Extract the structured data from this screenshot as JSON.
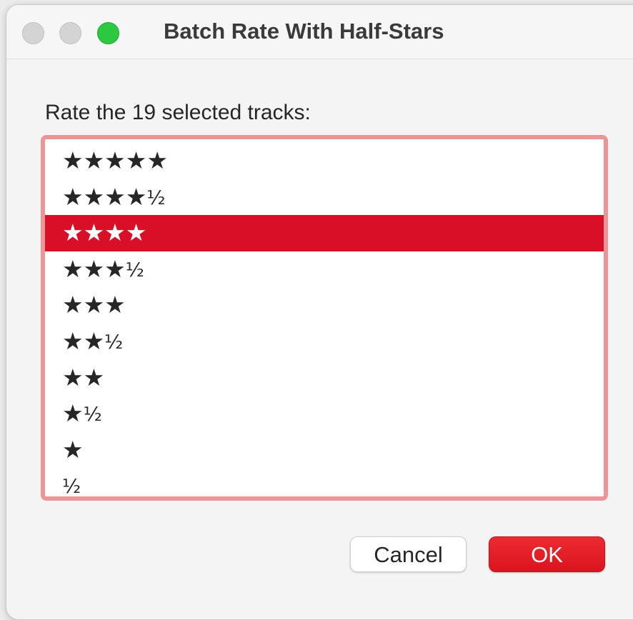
{
  "window": {
    "title": "Batch Rate With Half-Stars"
  },
  "dialog": {
    "prompt": "Rate the 19 selected tracks:",
    "ratings": [
      {
        "stars": "★★★★★",
        "half": ""
      },
      {
        "stars": "★★★★",
        "half": "½"
      },
      {
        "stars": "★★★★",
        "half": ""
      },
      {
        "stars": "★★★",
        "half": "½"
      },
      {
        "stars": "★★★",
        "half": ""
      },
      {
        "stars": "★★",
        "half": "½"
      },
      {
        "stars": "★★",
        "half": ""
      },
      {
        "stars": "★",
        "half": "½"
      },
      {
        "stars": "★",
        "half": ""
      },
      {
        "stars": "",
        "half": "½"
      }
    ],
    "selected_index": 2
  },
  "buttons": {
    "cancel_label": "Cancel",
    "ok_label": "OK"
  },
  "colors": {
    "selection": "#d90f28",
    "focus_ring": "#ec9496",
    "ok_button": "#e1161f",
    "zoom_button": "#2bc840"
  }
}
